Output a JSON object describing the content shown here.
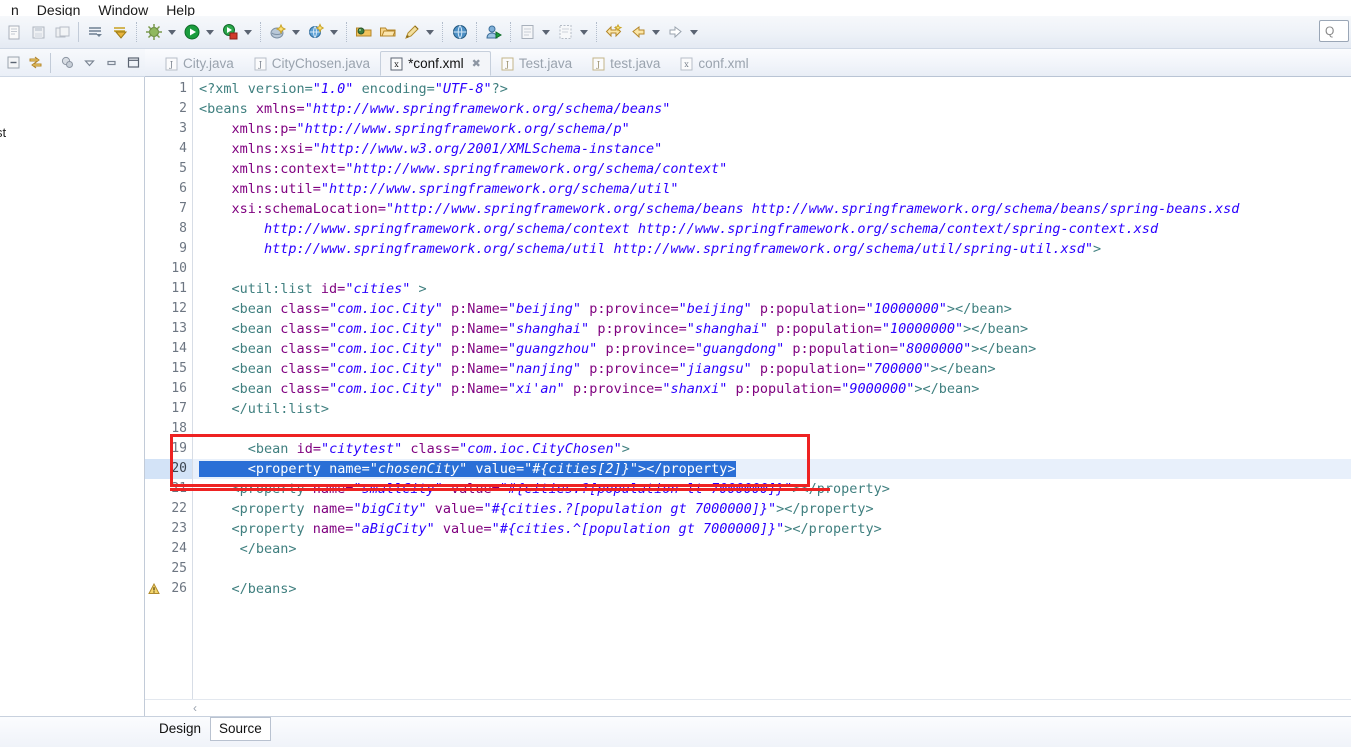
{
  "menubar": {
    "items": [
      "n",
      "Design",
      "Window",
      "Help"
    ]
  },
  "toolbar": {
    "icons": [
      "new-wizard-icon",
      "save-icon",
      "save-all-icon",
      "next-annotation-icon",
      "previous-annotation-icon",
      "debug-icon",
      "debug-dropdown-caret",
      "run-icon",
      "run-dropdown-caret",
      "run-external-tools-icon",
      "external-tools-dropdown-caret",
      "new-java-package-icon",
      "new-package-dropdown-caret",
      "new-server-icon",
      "new-server-dropdown-caret",
      "open-type-icon",
      "open-resource-icon",
      "search-icon",
      "search-dropdown-caret",
      "open-web-browser-icon",
      "run-as-icon",
      "new-view-icon",
      "new-view-dropdown-caret",
      "toggle-breakpoint-icon",
      "toggle-dropdown-caret",
      "back-to-icon",
      "back-icon",
      "back-dropdown-caret",
      "forward-icon",
      "forward-dropdown-caret"
    ],
    "search_value": "Q"
  },
  "viewbar": {
    "icons": [
      "collapse-all-icon",
      "link-with-editor-icon",
      "filters-icon",
      "view-menu-icon",
      "minimize-icon",
      "maximize-icon"
    ]
  },
  "left_panel": {
    "fragment_text": "st"
  },
  "editor_tabs": [
    {
      "label": "City.java",
      "icon": "java-file-icon",
      "active": false,
      "closable": false
    },
    {
      "label": "CityChosen.java",
      "icon": "java-file-icon",
      "active": false,
      "closable": false
    },
    {
      "label": "*conf.xml",
      "icon": "xml-file-icon",
      "active": true,
      "closable": true
    },
    {
      "label": "Test.java",
      "icon": "java-file-icon",
      "active": false,
      "closable": false
    },
    {
      "label": "test.java",
      "icon": "java-file-icon",
      "active": false,
      "closable": false
    },
    {
      "label": "conf.xml",
      "icon": "xml-file-icon",
      "active": false,
      "closable": false
    }
  ],
  "editor": {
    "selected_line": 20,
    "warning_line": 26,
    "selection_color": "#2a6fd6",
    "selection_row_color": "#e8f0fb",
    "annotation_color": "#ee2222",
    "lines": [
      {
        "n": 1,
        "tokens": [
          {
            "t": "pi",
            "s": "<?xml version="
          },
          {
            "t": "val",
            "s": "\"1.0\""
          },
          {
            "t": "pi",
            "s": " encoding="
          },
          {
            "t": "val",
            "s": "\"UTF-8\""
          },
          {
            "t": "pi",
            "s": "?>"
          }
        ]
      },
      {
        "n": 2,
        "tokens": [
          {
            "t": "tag",
            "s": "<beans "
          },
          {
            "t": "attr",
            "s": "xmlns="
          },
          {
            "t": "val",
            "s": "\"http://www.springframework.org/schema/beans\""
          }
        ]
      },
      {
        "n": 3,
        "tokens": [
          {
            "t": "plain",
            "s": "    "
          },
          {
            "t": "attr",
            "s": "xmlns:p="
          },
          {
            "t": "val",
            "s": "\"http://www.springframework.org/schema/p\""
          }
        ]
      },
      {
        "n": 4,
        "tokens": [
          {
            "t": "plain",
            "s": "    "
          },
          {
            "t": "attr",
            "s": "xmlns:xsi="
          },
          {
            "t": "val",
            "s": "\"http://www.w3.org/2001/XMLSchema-instance\""
          }
        ]
      },
      {
        "n": 5,
        "tokens": [
          {
            "t": "plain",
            "s": "    "
          },
          {
            "t": "attr",
            "s": "xmlns:context="
          },
          {
            "t": "val",
            "s": "\"http://www.springframework.org/schema/context\""
          }
        ]
      },
      {
        "n": 6,
        "tokens": [
          {
            "t": "plain",
            "s": "    "
          },
          {
            "t": "attr",
            "s": "xmlns:util="
          },
          {
            "t": "val",
            "s": "\"http://www.springframework.org/schema/util\""
          }
        ]
      },
      {
        "n": 7,
        "tokens": [
          {
            "t": "plain",
            "s": "    "
          },
          {
            "t": "attr",
            "s": "xsi:schemaLocation="
          },
          {
            "t": "val",
            "s": "\"http://www.springframework.org/schema/beans http://www.springframework.org/schema/beans/spring-beans.xsd"
          }
        ]
      },
      {
        "n": 8,
        "tokens": [
          {
            "t": "val",
            "s": "        http://www.springframework.org/schema/context http://www.springframework.org/schema/context/spring-context.xsd"
          }
        ]
      },
      {
        "n": 9,
        "tokens": [
          {
            "t": "val",
            "s": "        http://www.springframework.org/schema/util http://www.springframework.org/schema/util/spring-util.xsd\""
          },
          {
            "t": "tag",
            "s": ">"
          }
        ]
      },
      {
        "n": 10,
        "tokens": []
      },
      {
        "n": 11,
        "tokens": [
          {
            "t": "plain",
            "s": "    "
          },
          {
            "t": "tag",
            "s": "<util:list "
          },
          {
            "t": "attr",
            "s": "id="
          },
          {
            "t": "val",
            "s": "\"cities\""
          },
          {
            "t": "tag",
            "s": " >"
          }
        ]
      },
      {
        "n": 12,
        "tokens": [
          {
            "t": "plain",
            "s": "    "
          },
          {
            "t": "tag",
            "s": "<bean "
          },
          {
            "t": "attr",
            "s": "class="
          },
          {
            "t": "val",
            "s": "\"com.ioc.City\""
          },
          {
            "t": "attr",
            "s": " p:Name="
          },
          {
            "t": "val",
            "s": "\"beijing\""
          },
          {
            "t": "attr",
            "s": " p:province="
          },
          {
            "t": "val",
            "s": "\"beijing\""
          },
          {
            "t": "attr",
            "s": " p:population="
          },
          {
            "t": "val",
            "s": "\"10000000\""
          },
          {
            "t": "tag",
            "s": "></bean>"
          }
        ]
      },
      {
        "n": 13,
        "tokens": [
          {
            "t": "plain",
            "s": "    "
          },
          {
            "t": "tag",
            "s": "<bean "
          },
          {
            "t": "attr",
            "s": "class="
          },
          {
            "t": "val",
            "s": "\"com.ioc.City\""
          },
          {
            "t": "attr",
            "s": " p:Name="
          },
          {
            "t": "val",
            "s": "\"shanghai\""
          },
          {
            "t": "attr",
            "s": " p:province="
          },
          {
            "t": "val",
            "s": "\"shanghai\""
          },
          {
            "t": "attr",
            "s": " p:population="
          },
          {
            "t": "val",
            "s": "\"10000000\""
          },
          {
            "t": "tag",
            "s": "></bean>"
          }
        ]
      },
      {
        "n": 14,
        "tokens": [
          {
            "t": "plain",
            "s": "    "
          },
          {
            "t": "tag",
            "s": "<bean "
          },
          {
            "t": "attr",
            "s": "class="
          },
          {
            "t": "val",
            "s": "\"com.ioc.City\""
          },
          {
            "t": "attr",
            "s": " p:Name="
          },
          {
            "t": "val",
            "s": "\"guangzhou\""
          },
          {
            "t": "attr",
            "s": " p:province="
          },
          {
            "t": "val",
            "s": "\"guangdong\""
          },
          {
            "t": "attr",
            "s": " p:population="
          },
          {
            "t": "val",
            "s": "\"8000000\""
          },
          {
            "t": "tag",
            "s": "></bean>"
          }
        ]
      },
      {
        "n": 15,
        "tokens": [
          {
            "t": "plain",
            "s": "    "
          },
          {
            "t": "tag",
            "s": "<bean "
          },
          {
            "t": "attr",
            "s": "class="
          },
          {
            "t": "val",
            "s": "\"com.ioc.City\""
          },
          {
            "t": "attr",
            "s": " p:Name="
          },
          {
            "t": "val",
            "s": "\"nanjing\""
          },
          {
            "t": "attr",
            "s": " p:province="
          },
          {
            "t": "val",
            "s": "\"jiangsu\""
          },
          {
            "t": "attr",
            "s": " p:population="
          },
          {
            "t": "val",
            "s": "\"700000\""
          },
          {
            "t": "tag",
            "s": "></bean>"
          }
        ]
      },
      {
        "n": 16,
        "tokens": [
          {
            "t": "plain",
            "s": "    "
          },
          {
            "t": "tag",
            "s": "<bean "
          },
          {
            "t": "attr",
            "s": "class="
          },
          {
            "t": "val",
            "s": "\"com.ioc.City\""
          },
          {
            "t": "attr",
            "s": " p:Name="
          },
          {
            "t": "val",
            "s": "\"xi'an\""
          },
          {
            "t": "attr",
            "s": " p:province="
          },
          {
            "t": "val",
            "s": "\"shanxi\""
          },
          {
            "t": "attr",
            "s": " p:population="
          },
          {
            "t": "val",
            "s": "\"9000000\""
          },
          {
            "t": "tag",
            "s": "></bean>"
          }
        ]
      },
      {
        "n": 17,
        "tokens": [
          {
            "t": "plain",
            "s": "    "
          },
          {
            "t": "tag",
            "s": "</util:list>"
          }
        ]
      },
      {
        "n": 18,
        "tokens": []
      },
      {
        "n": 19,
        "tokens": [
          {
            "t": "plain",
            "s": "      "
          },
          {
            "t": "tag",
            "s": "<bean "
          },
          {
            "t": "attr",
            "s": "id="
          },
          {
            "t": "val",
            "s": "\"citytest\""
          },
          {
            "t": "attr",
            "s": " class="
          },
          {
            "t": "val",
            "s": "\"com.ioc.CityChosen\""
          },
          {
            "t": "tag",
            "s": ">"
          }
        ]
      },
      {
        "n": 20,
        "selected": true,
        "tokens": [
          {
            "t": "plain",
            "s": "      "
          },
          {
            "t": "tag",
            "s": "<property "
          },
          {
            "t": "attr",
            "s": "name="
          },
          {
            "t": "val",
            "s": "\"chosenCity\""
          },
          {
            "t": "attr",
            "s": " value="
          },
          {
            "t": "val",
            "s": "\"#{cities[2]}\""
          },
          {
            "t": "tag",
            "s": "></property>"
          }
        ]
      },
      {
        "n": 21,
        "struck": true,
        "tokens": [
          {
            "t": "plain",
            "s": "    "
          },
          {
            "t": "tag",
            "s": "<property "
          },
          {
            "t": "attr",
            "s": "name="
          },
          {
            "t": "val",
            "s": "\"smallCity\""
          },
          {
            "t": "attr",
            "s": " value="
          },
          {
            "t": "val",
            "s": "\"#{cities.?[population lt 7000000]}\""
          },
          {
            "t": "tag",
            "s": "></property>"
          }
        ]
      },
      {
        "n": 22,
        "tokens": [
          {
            "t": "plain",
            "s": "    "
          },
          {
            "t": "tag",
            "s": "<property "
          },
          {
            "t": "attr",
            "s": "name="
          },
          {
            "t": "val",
            "s": "\"bigCity\""
          },
          {
            "t": "attr",
            "s": " value="
          },
          {
            "t": "val",
            "s": "\"#{cities.?[population gt 7000000]}\""
          },
          {
            "t": "tag",
            "s": "></property>"
          }
        ]
      },
      {
        "n": 23,
        "tokens": [
          {
            "t": "plain",
            "s": "    "
          },
          {
            "t": "tag",
            "s": "<property "
          },
          {
            "t": "attr",
            "s": "name="
          },
          {
            "t": "val",
            "s": "\"aBigCity\""
          },
          {
            "t": "attr",
            "s": " value="
          },
          {
            "t": "val",
            "s": "\"#{cities.^[population gt 7000000]}\""
          },
          {
            "t": "tag",
            "s": "></property>"
          }
        ]
      },
      {
        "n": 24,
        "tokens": [
          {
            "t": "plain",
            "s": "     "
          },
          {
            "t": "tag",
            "s": "</bean>"
          }
        ]
      },
      {
        "n": 25,
        "tokens": []
      },
      {
        "n": 26,
        "warning": true,
        "tokens": [
          {
            "t": "plain",
            "s": "    "
          },
          {
            "t": "tag",
            "s": "</beans>"
          }
        ]
      }
    ]
  },
  "page_tabs": [
    {
      "label": "Design",
      "active": false
    },
    {
      "label": "Source",
      "active": true
    }
  ],
  "scroll": {
    "left_arrow": "‹"
  }
}
